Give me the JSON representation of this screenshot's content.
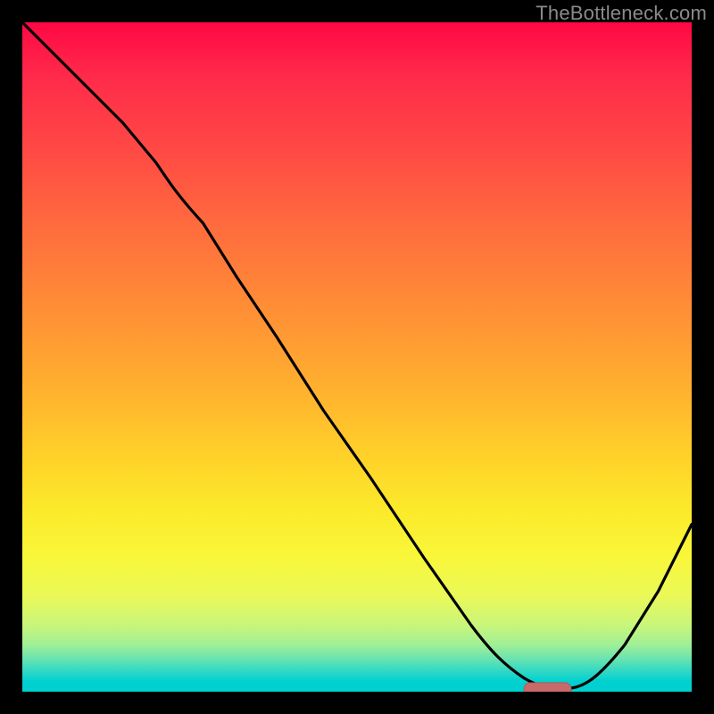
{
  "watermark": "TheBottleneck.com",
  "colors": {
    "frame": "#000000",
    "curve": "#000000",
    "marker": "#c96a6a",
    "marker_stroke": "#b45555"
  },
  "chart_data": {
    "type": "line",
    "title": "",
    "xlabel": "",
    "ylabel": "",
    "xlim": [
      0,
      100
    ],
    "ylim": [
      0,
      100
    ],
    "grid": false,
    "series": [
      {
        "name": "bottleneck-curve",
        "x": [
          0,
          5,
          10,
          15,
          20,
          23,
          27,
          32,
          38,
          45,
          52,
          60,
          67,
          72,
          75,
          78,
          80,
          85,
          90,
          95,
          100
        ],
        "values": [
          100,
          95,
          90,
          85,
          79,
          75,
          70,
          62,
          53,
          42,
          32,
          20,
          10,
          4,
          1,
          0,
          0,
          4,
          12,
          22,
          34
        ]
      }
    ],
    "optimal_marker": {
      "x_start": 75,
      "x_end": 80,
      "y": 0
    },
    "gradient_stops": [
      {
        "pos": 0,
        "color": "#ff0844"
      },
      {
        "pos": 0.3,
        "color": "#ff6a3e"
      },
      {
        "pos": 0.6,
        "color": "#ffd229"
      },
      {
        "pos": 0.82,
        "color": "#f9f73a"
      },
      {
        "pos": 0.95,
        "color": "#6be4b0"
      },
      {
        "pos": 1.0,
        "color": "#00d0cf"
      }
    ]
  }
}
